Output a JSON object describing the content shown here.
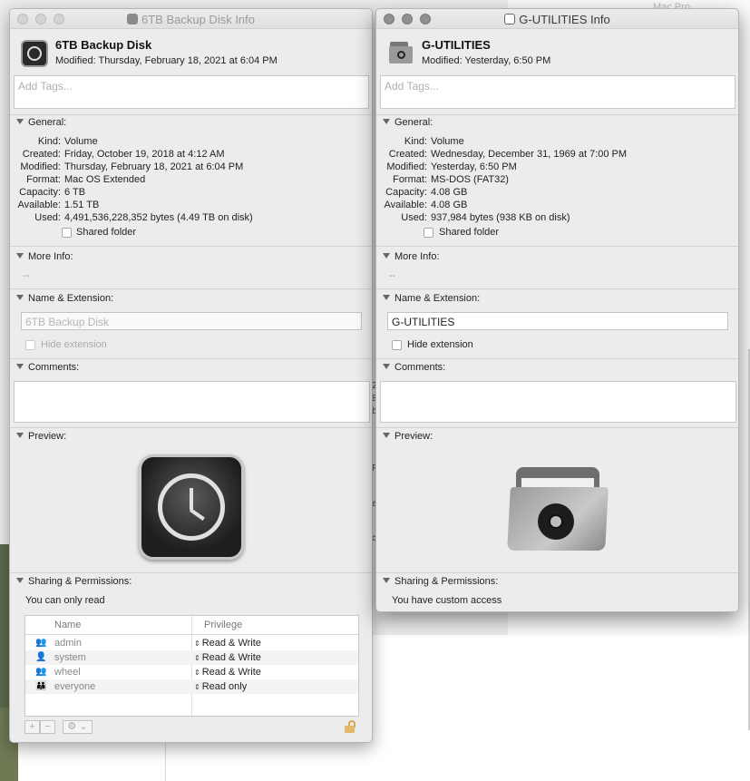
{
  "left": {
    "title": "6TB Backup Disk Info",
    "name": "6TB Backup Disk",
    "modified_line": "Modified: Thursday, February 18, 2021 at 6:04 PM",
    "tags_placeholder": "Add Tags...",
    "general_label": "General:",
    "general": {
      "kind_k": "Kind:",
      "kind_v": "Volume",
      "created_k": "Created:",
      "created_v": "Friday, October 19, 2018 at 4:12 AM",
      "modified_k": "Modified:",
      "modified_v": "Thursday, February 18, 2021 at 6:04 PM",
      "format_k": "Format:",
      "format_v": "Mac OS Extended",
      "capacity_k": "Capacity:",
      "capacity_v": "6 TB",
      "available_k": "Available:",
      "available_v": "1.51 TB",
      "used_k": "Used:",
      "used_v": "4,491,536,228,352 bytes (4.49 TB on disk)"
    },
    "shared_folder": "Shared folder",
    "more_info_label": "More Info:",
    "more_info_value": "--",
    "name_ext_label": "Name & Extension:",
    "name_field": "6TB Backup Disk",
    "hide_extension": "Hide extension",
    "comments_label": "Comments:",
    "preview_label": "Preview:",
    "sharing_label": "Sharing & Permissions:",
    "access_text": "You can only read",
    "table": {
      "col_name": "Name",
      "col_priv": "Privilege",
      "rows": [
        {
          "name": "admin",
          "priv": "Read & Write"
        },
        {
          "name": "system",
          "priv": "Read & Write"
        },
        {
          "name": "wheel",
          "priv": "Read & Write"
        },
        {
          "name": "everyone",
          "priv": "Read only"
        }
      ]
    },
    "toolbar": {
      "add": "+",
      "remove": "−",
      "action": "⚙ ⌄"
    }
  },
  "right": {
    "title": "G-UTILITIES Info",
    "name": "G-UTILITIES",
    "modified_line": "Modified: Yesterday, 6:50 PM",
    "tags_placeholder": "Add Tags...",
    "general_label": "General:",
    "general": {
      "kind_k": "Kind:",
      "kind_v": "Volume",
      "created_k": "Created:",
      "created_v": "Wednesday, December 31, 1969 at 7:00 PM",
      "modified_k": "Modified:",
      "modified_v": "Yesterday, 6:50 PM",
      "format_k": "Format:",
      "format_v": "MS-DOS (FAT32)",
      "capacity_k": "Capacity:",
      "capacity_v": "4.08 GB",
      "available_k": "Available:",
      "available_v": "4.08 GB",
      "used_k": "Used:",
      "used_v": "937,984 bytes (938 KB on disk)"
    },
    "shared_folder": "Shared folder",
    "more_info_label": "More Info:",
    "more_info_value": "--",
    "name_ext_label": "Name & Extension:",
    "name_field": "G-UTILITIES",
    "hide_extension": "Hide extension",
    "comments_label": "Comments:",
    "preview_label": "Preview:",
    "sharing_label": "Sharing & Permissions:",
    "access_text": "You have custom access"
  },
  "background": {
    "top_title": "Mac Pro",
    "glyphs": [
      "2",
      "8",
      "b",
      "F",
      "e",
      "c"
    ]
  },
  "colors": {
    "window_bg": "#ececec",
    "lock_gold": "#e2b86a"
  }
}
